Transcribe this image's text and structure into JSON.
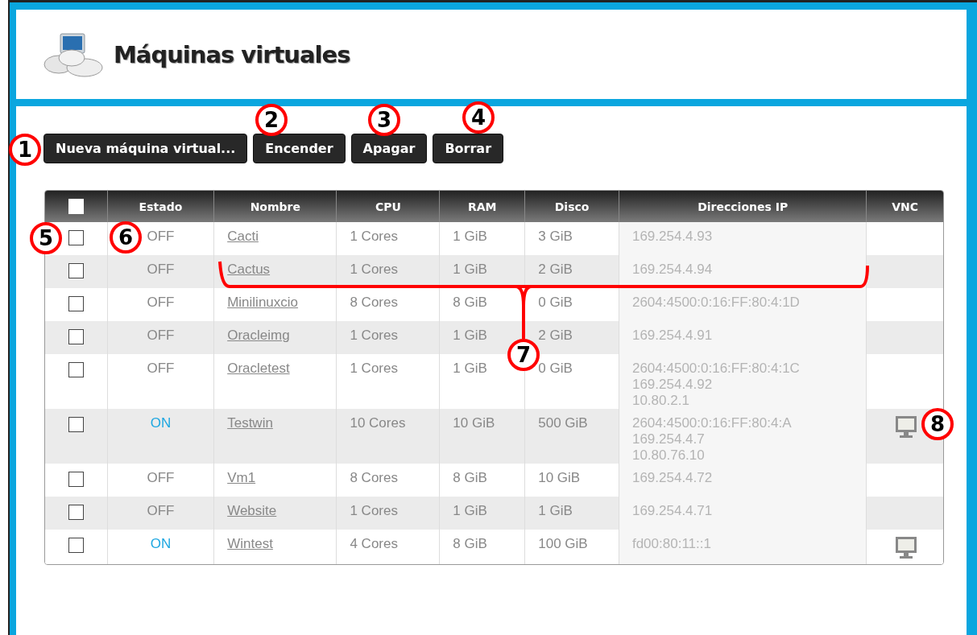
{
  "header": {
    "title": "Máquinas virtuales"
  },
  "toolbar": {
    "buttons": [
      "Nueva máquina virtual...",
      "Encender",
      "Apagar",
      "Borrar"
    ]
  },
  "table": {
    "select_all": {
      "checked": false
    },
    "columns": [
      "Estado",
      "Nombre",
      "CPU",
      "RAM",
      "Disco",
      "Direcciones IP",
      "VNC"
    ],
    "rows": [
      {
        "checked": false,
        "status": "OFF",
        "on": false,
        "name": "Cacti",
        "cpu": "1 Cores",
        "ram": "1 GiB",
        "disk": "3 GiB",
        "ips": [
          "169.254.4.93"
        ],
        "vnc": false
      },
      {
        "checked": false,
        "status": "OFF",
        "on": false,
        "name": "Cactus",
        "cpu": "1 Cores",
        "ram": "1 GiB",
        "disk": "2 GiB",
        "ips": [
          "169.254.4.94"
        ],
        "vnc": false
      },
      {
        "checked": false,
        "status": "OFF",
        "on": false,
        "name": "Minilinuxcio",
        "cpu": "8 Cores",
        "ram": "8 GiB",
        "disk": "0 GiB",
        "ips": [
          "2604:4500:0:16:FF:80:4:1D"
        ],
        "vnc": false
      },
      {
        "checked": false,
        "status": "OFF",
        "on": false,
        "name": "Oracleimg",
        "cpu": "1 Cores",
        "ram": "1 GiB",
        "disk": "2 GiB",
        "ips": [
          "169.254.4.91"
        ],
        "vnc": false
      },
      {
        "checked": false,
        "status": "OFF",
        "on": false,
        "name": "Oracletest",
        "cpu": "1 Cores",
        "ram": "1 GiB",
        "disk": "0 GiB",
        "ips": [
          "2604:4500:0:16:FF:80:4:1C",
          "169.254.4.92",
          "10.80.2.1"
        ],
        "vnc": false
      },
      {
        "checked": false,
        "status": "ON",
        "on": true,
        "name": "Testwin",
        "cpu": "10 Cores",
        "ram": "10 GiB",
        "disk": "500 GiB",
        "ips": [
          "2604:4500:0:16:FF:80:4:A",
          "169.254.4.7",
          "10.80.76.10"
        ],
        "vnc": true
      },
      {
        "checked": false,
        "status": "OFF",
        "on": false,
        "name": "Vm1",
        "cpu": "8 Cores",
        "ram": "8 GiB",
        "disk": "10 GiB",
        "ips": [
          "169.254.4.72"
        ],
        "vnc": false
      },
      {
        "checked": false,
        "status": "OFF",
        "on": false,
        "name": "Website",
        "cpu": "1 Cores",
        "ram": "1 GiB",
        "disk": "1 GiB",
        "ips": [
          "169.254.4.71"
        ],
        "vnc": false
      },
      {
        "checked": false,
        "status": "ON",
        "on": true,
        "name": "Wintest",
        "cpu": "4 Cores",
        "ram": "8 GiB",
        "disk": "100 GiB",
        "ips": [
          "fd00:80:11::1"
        ],
        "vnc": true
      }
    ]
  },
  "annotations": [
    {
      "label": "1"
    },
    {
      "label": "2"
    },
    {
      "label": "3"
    },
    {
      "label": "4"
    },
    {
      "label": "5"
    },
    {
      "label": "6"
    },
    {
      "label": "7"
    },
    {
      "label": "8"
    }
  ]
}
